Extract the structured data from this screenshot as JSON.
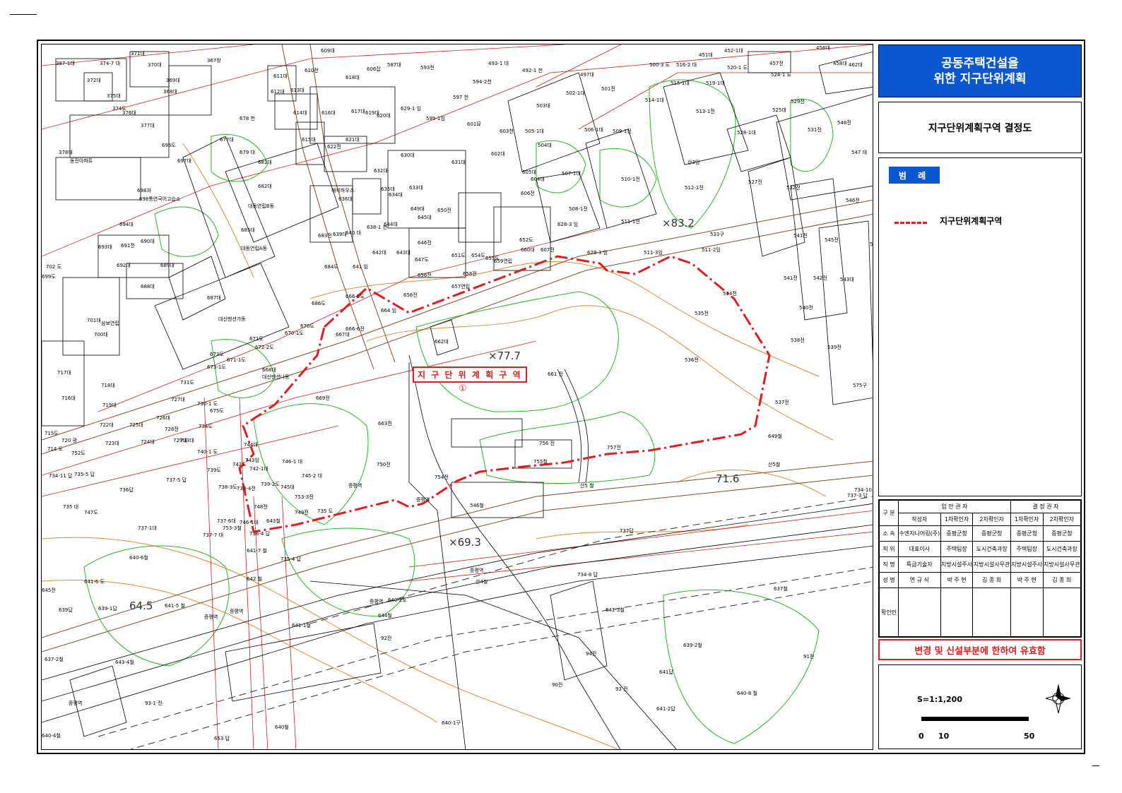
{
  "title": {
    "line1": "공동주택건설을",
    "line2": "위한 지구단위계획"
  },
  "subtitle": "지구단위계획구역 결정도",
  "legend": {
    "badge": "범 례",
    "item_label": "지구단위계획구역",
    "line_color": "#e01e1e"
  },
  "zone": {
    "label": "지 구 단 위 계 획 구 역",
    "number": "①"
  },
  "elevations": [
    "×77.7",
    "×83.2",
    "×69.3",
    "64.5",
    "71.6"
  ],
  "map_labels": [
    {
      "t": "387-1대"
    },
    {
      "t": "374-7 대"
    },
    {
      "t": "371대"
    },
    {
      "t": "370대"
    },
    {
      "t": "367창"
    },
    {
      "t": "609대"
    },
    {
      "t": "606잡"
    },
    {
      "t": "587대"
    },
    {
      "t": "593천"
    },
    {
      "t": "493-1 대"
    },
    {
      "t": "492-1 천"
    },
    {
      "t": "497대"
    },
    {
      "t": "501전"
    },
    {
      "t": "451대"
    },
    {
      "t": "452-1대"
    },
    {
      "t": "457전"
    },
    {
      "t": "456대"
    },
    {
      "t": "458대"
    },
    {
      "t": "462대"
    },
    {
      "t": "372대"
    },
    {
      "t": "369대"
    },
    {
      "t": "611대"
    },
    {
      "t": "610전"
    },
    {
      "t": "618대"
    },
    {
      "t": "594-2천"
    },
    {
      "t": "500-3 도"
    },
    {
      "t": "516-2 대"
    },
    {
      "t": "520-1 도"
    },
    {
      "t": "524-1 도"
    },
    {
      "t": "375대"
    },
    {
      "t": "368대"
    },
    {
      "t": "612대"
    },
    {
      "t": "613대"
    },
    {
      "t": "597 천"
    },
    {
      "t": "502-1대"
    },
    {
      "t": "515-1대"
    },
    {
      "t": "519-1대"
    },
    {
      "t": "374도"
    },
    {
      "t": "376대"
    },
    {
      "t": "614대"
    },
    {
      "t": "616대"
    },
    {
      "t": "617대"
    },
    {
      "t": "619대"
    },
    {
      "t": "620대"
    },
    {
      "t": "629-1 임"
    },
    {
      "t": "503대"
    },
    {
      "t": "514-1대"
    },
    {
      "t": "525대"
    },
    {
      "t": "529전"
    },
    {
      "t": "377대"
    },
    {
      "t": "678 천"
    },
    {
      "t": "599-1임"
    },
    {
      "t": "601묘"
    },
    {
      "t": "603천"
    },
    {
      "t": "505-1대"
    },
    {
      "t": "506-1대"
    },
    {
      "t": "509-1전"
    },
    {
      "t": "513-1전"
    },
    {
      "t": "531전"
    },
    {
      "t": "548전"
    },
    {
      "t": "378대"
    },
    {
      "t": "동진아파트"
    },
    {
      "t": "696도"
    },
    {
      "t": "677대"
    },
    {
      "t": "615대"
    },
    {
      "t": "621대"
    },
    {
      "t": "622전"
    },
    {
      "t": "504대"
    },
    {
      "t": "528-1대"
    },
    {
      "t": "547 대"
    },
    {
      "t": "679 대"
    },
    {
      "t": "697대"
    },
    {
      "t": "681대"
    },
    {
      "t": "630대"
    },
    {
      "t": "631대"
    },
    {
      "t": "602대"
    },
    {
      "t": "산3임"
    },
    {
      "t": "698과"
    },
    {
      "t": "698통연국어고습소"
    },
    {
      "t": "682대"
    },
    {
      "t": "해피하우스"
    },
    {
      "t": "636대"
    },
    {
      "t": "635대"
    },
    {
      "t": "634대"
    },
    {
      "t": "632대"
    },
    {
      "t": "633대"
    },
    {
      "t": "605대"
    },
    {
      "t": "604대"
    },
    {
      "t": "507-1대"
    },
    {
      "t": "510-1전"
    },
    {
      "t": "512-1전"
    },
    {
      "t": "527전"
    },
    {
      "t": "532전"
    },
    {
      "t": "대동연립B동"
    },
    {
      "t": "650전"
    },
    {
      "t": "649대"
    },
    {
      "t": "606전"
    },
    {
      "t": "508-1전"
    },
    {
      "t": "546전"
    },
    {
      "t": "694대"
    },
    {
      "t": "685대"
    },
    {
      "t": "638-1 천"
    },
    {
      "t": "644대"
    },
    {
      "t": "645대"
    },
    {
      "t": "628-3 임"
    },
    {
      "t": "511-1전"
    },
    {
      "t": "533구"
    },
    {
      "t": "541전"
    },
    {
      "t": "545전"
    },
    {
      "t": "544전"
    },
    {
      "t": "693대"
    },
    {
      "t": "691전"
    },
    {
      "t": "690대"
    },
    {
      "t": "대동연립A동"
    },
    {
      "t": "683전"
    },
    {
      "t": "639대"
    },
    {
      "t": "640 대"
    },
    {
      "t": "646전"
    },
    {
      "t": "607전"
    },
    {
      "t": "652도"
    },
    {
      "t": "511-2임"
    },
    {
      "t": "642대"
    },
    {
      "t": "643대"
    },
    {
      "t": "660대"
    },
    {
      "t": "629-3 임"
    },
    {
      "t": "511-3임"
    },
    {
      "t": "702 도"
    },
    {
      "t": "692대"
    },
    {
      "t": "689대"
    },
    {
      "t": "684도"
    },
    {
      "t": "641 임"
    },
    {
      "t": "647도"
    },
    {
      "t": "651도"
    },
    {
      "t": "654도"
    },
    {
      "t": "655도"
    },
    {
      "t": "659연립"
    },
    {
      "t": "541전"
    },
    {
      "t": "542전"
    },
    {
      "t": "543대"
    },
    {
      "t": "699도"
    },
    {
      "t": "688대"
    },
    {
      "t": "656전"
    },
    {
      "t": "658전"
    },
    {
      "t": "657연립"
    },
    {
      "t": "534전"
    },
    {
      "t": "687대"
    },
    {
      "t": "666-5도"
    },
    {
      "t": "656전"
    },
    {
      "t": "540전"
    },
    {
      "t": "701대"
    },
    {
      "t": "삼보연립"
    },
    {
      "t": "대신맨션가동"
    },
    {
      "t": "686도"
    },
    {
      "t": "664 임"
    },
    {
      "t": "535전"
    },
    {
      "t": "700대"
    },
    {
      "t": "670도"
    },
    {
      "t": "667대"
    },
    {
      "t": "666-6전"
    },
    {
      "t": "662대"
    },
    {
      "t": "538전"
    },
    {
      "t": "671도"
    },
    {
      "t": "670-1도"
    },
    {
      "t": "672-2도"
    },
    {
      "t": "539전"
    },
    {
      "t": "717대"
    },
    {
      "t": "673도"
    },
    {
      "t": "671-1도"
    },
    {
      "t": "673-1도"
    },
    {
      "t": "668대"
    },
    {
      "t": "536전"
    },
    {
      "t": "대신맨션나동"
    },
    {
      "t": "661 전"
    },
    {
      "t": "718대"
    },
    {
      "t": "731도"
    },
    {
      "t": "575구"
    },
    {
      "t": "716대"
    },
    {
      "t": "719대"
    },
    {
      "t": "727대"
    },
    {
      "t": "730-1 도"
    },
    {
      "t": "669전"
    },
    {
      "t": "537전"
    },
    {
      "t": "675도"
    },
    {
      "t": "722대"
    },
    {
      "t": "725대"
    },
    {
      "t": "726대"
    },
    {
      "t": "728전"
    },
    {
      "t": "734도"
    },
    {
      "t": "663전"
    },
    {
      "t": "715도"
    },
    {
      "t": "720 광"
    },
    {
      "t": "723대"
    },
    {
      "t": "724대"
    },
    {
      "t": "729대"
    },
    {
      "t": "733대"
    },
    {
      "t": "649철"
    },
    {
      "t": "714 도"
    },
    {
      "t": "752도"
    },
    {
      "t": "744대"
    },
    {
      "t": "756 전"
    },
    {
      "t": "757전"
    },
    {
      "t": "743임"
    },
    {
      "t": "740-1 도"
    },
    {
      "t": "746-1 대"
    },
    {
      "t": "755철"
    },
    {
      "t": "산5철"
    },
    {
      "t": "734-11 답"
    },
    {
      "t": "735-5 답"
    },
    {
      "t": "739도"
    },
    {
      "t": "742도"
    },
    {
      "t": "742-1대"
    },
    {
      "t": "745-2 대"
    },
    {
      "t": "750전"
    },
    {
      "t": "754전"
    },
    {
      "t": "736답"
    },
    {
      "t": "737-5 답"
    },
    {
      "t": "738-3도"
    },
    {
      "t": "738-4전"
    },
    {
      "t": "739-2도"
    },
    {
      "t": "745대"
    },
    {
      "t": "증평역"
    },
    {
      "t": "산5 철"
    },
    {
      "t": "734-10 대"
    },
    {
      "t": "735 대"
    },
    {
      "t": "747도"
    },
    {
      "t": "753-3전"
    },
    {
      "t": "증평역"
    },
    {
      "t": "546철"
    },
    {
      "t": "737-3 답"
    },
    {
      "t": "748전"
    },
    {
      "t": "749전"
    },
    {
      "t": "735 도"
    },
    {
      "t": "737-1대"
    },
    {
      "t": "737-6대"
    },
    {
      "t": "746-1대"
    },
    {
      "t": "643철"
    },
    {
      "t": "737답"
    },
    {
      "t": "737-7 대"
    },
    {
      "t": "753-3철"
    },
    {
      "t": "736-4 답"
    },
    {
      "t": "640-6철"
    },
    {
      "t": "641-7 철"
    },
    {
      "t": "735-4 답"
    },
    {
      "t": "641-6 도"
    },
    {
      "t": "642 철"
    },
    {
      "t": "증평역"
    },
    {
      "t": "산4철"
    },
    {
      "t": "734-8 답"
    },
    {
      "t": "645전"
    },
    {
      "t": "637철"
    },
    {
      "t": "639답"
    },
    {
      "t": "639-1답"
    },
    {
      "t": "641-5 철"
    },
    {
      "t": "증평역"
    },
    {
      "t": "증평역"
    },
    {
      "t": "640-2도"
    },
    {
      "t": "증평역"
    },
    {
      "t": "644철"
    },
    {
      "t": "641-3철"
    },
    {
      "t": "641-1철"
    },
    {
      "t": "92전"
    },
    {
      "t": "639-2철"
    },
    {
      "t": "637-2철"
    },
    {
      "t": "643-4철"
    },
    {
      "t": "94전"
    },
    {
      "t": "91전"
    },
    {
      "t": "641답"
    },
    {
      "t": "90전"
    },
    {
      "t": "93 전"
    },
    {
      "t": "640-8 철"
    },
    {
      "t": "증평역"
    },
    {
      "t": "93-1 전"
    },
    {
      "t": "641-2답"
    },
    {
      "t": "640-1구"
    },
    {
      "t": "640철"
    },
    {
      "t": "640-4철"
    },
    {
      "t": "653 답"
    }
  ],
  "approval": {
    "group_label": "구 분",
    "drafter_group": "입 안 권 자",
    "decider_group": "결 정 권 자",
    "cols": [
      "작성자",
      "1차확인자",
      "2차확인자",
      "1차확인자",
      "2차확인자"
    ],
    "rows": [
      {
        "label": "소 속",
        "cells": [
          "수엔지니어링(주)",
          "증평군청",
          "증평군청",
          "증평군청",
          "증평군청"
        ]
      },
      {
        "label": "직 위",
        "cells": [
          "대표이사",
          "주택팀장",
          "도시건축과장",
          "주택팀장",
          "도시건축과장"
        ]
      },
      {
        "label": "직 명",
        "cells": [
          "특급기술자",
          "지방시설주사",
          "지방시설사무관",
          "지방시설주사",
          "지방시설사무관"
        ]
      },
      {
        "label": "성 명",
        "cells": [
          "연 규 식",
          "박 주 현",
          "김 종 희",
          "박 주 현",
          "김 종 희"
        ]
      },
      {
        "label": "확인인",
        "cells": [
          "",
          "",
          "",
          "",
          ""
        ]
      }
    ]
  },
  "notice": "변경 및 신설부분에 한하여 유효함",
  "scale": {
    "label": "S=1:1,200",
    "ticks": [
      "0",
      "10",
      "50"
    ]
  },
  "north_icon": "north-arrow-icon"
}
